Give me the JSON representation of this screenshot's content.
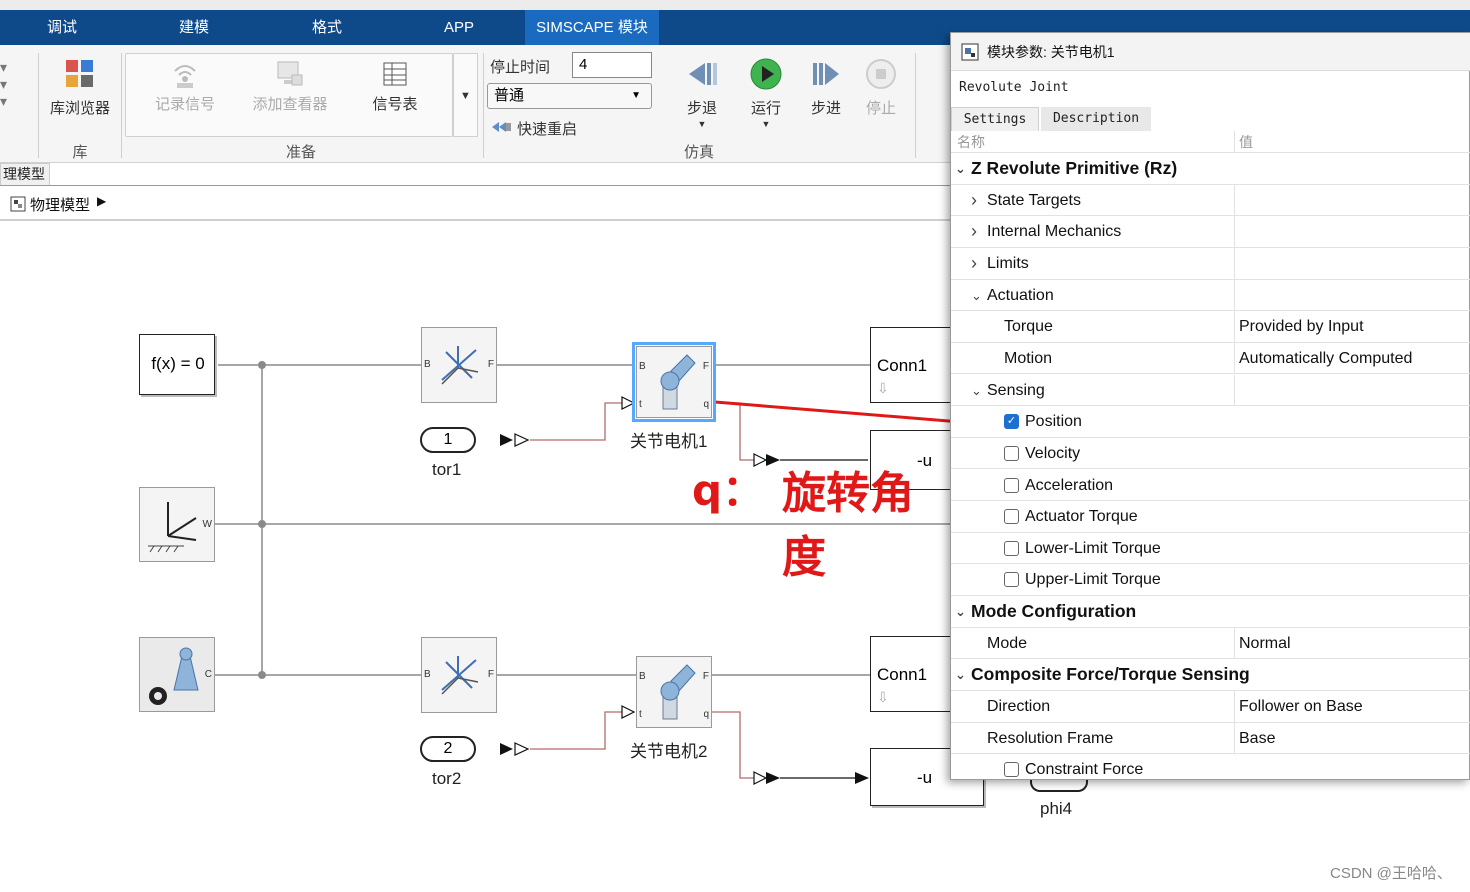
{
  "ribbon_tabs": [
    "调试",
    "建模",
    "格式",
    "APP",
    "SIMSCAPE 模块"
  ],
  "ribbon": {
    "library_browser": "库浏览器",
    "record_signal": "记录信号",
    "add_viewer": "添加查看器",
    "signal_table": "信号表",
    "stop_time_label": "停止时间",
    "stop_time_value": "4",
    "sim_mode": "普通",
    "fast_restart": "快速重启",
    "step_back": "步退",
    "run": "运行",
    "step_forward": "步进",
    "stop": "停止",
    "group_library": "库",
    "group_prepare": "准备",
    "group_simulation": "仿真"
  },
  "model_tab": "理模型",
  "breadcrumb": "物理模型",
  "diagram": {
    "fx_block": "f(x) = 0",
    "const1": "1",
    "const1_label": "tor1",
    "const2": "2",
    "const2_label": "tor2",
    "joint1_label": "关节电机1",
    "joint2_label": "关节电机2",
    "conn1_top": "Conn1",
    "conn1_bottom": "Conn1",
    "neg_u_top": "-u",
    "neg_u_bottom": "-u",
    "phi4_label": "phi4",
    "ports": {
      "b": "B",
      "f": "F",
      "t": "t",
      "q": "q",
      "w": "W",
      "c": "C"
    }
  },
  "annotation": {
    "q_label": "q：",
    "text": "旋转角度"
  },
  "dialog": {
    "title": "模块参数: 关节电机1",
    "block_type": "Revolute Joint",
    "tabs": [
      "Settings",
      "Description"
    ],
    "col_name": "名称",
    "col_value": "值",
    "rows": [
      {
        "name": "Z Revolute Primitive (Rz)",
        "type": "section"
      },
      {
        "name": "State Targets",
        "type": "collapsed"
      },
      {
        "name": "Internal Mechanics",
        "type": "collapsed"
      },
      {
        "name": "Limits",
        "type": "collapsed"
      },
      {
        "name": "Actuation",
        "type": "expanded"
      },
      {
        "name": "Torque",
        "value": "Provided by Input",
        "type": "param"
      },
      {
        "name": "Motion",
        "value": "Automatically Computed",
        "type": "param"
      },
      {
        "name": "Sensing",
        "type": "expanded"
      },
      {
        "name": "Position",
        "type": "check",
        "checked": true
      },
      {
        "name": "Velocity",
        "type": "check",
        "checked": false
      },
      {
        "name": "Acceleration",
        "type": "check",
        "checked": false
      },
      {
        "name": "Actuator Torque",
        "type": "check",
        "checked": false
      },
      {
        "name": "Lower-Limit Torque",
        "type": "check",
        "checked": false
      },
      {
        "name": "Upper-Limit Torque",
        "type": "check",
        "checked": false
      },
      {
        "name": "Mode Configuration",
        "type": "section"
      },
      {
        "name": "Mode",
        "value": "Normal",
        "type": "param1"
      },
      {
        "name": "Composite Force/Torque Sensing",
        "type": "section"
      },
      {
        "name": "Direction",
        "value": "Follower on Base",
        "type": "param1"
      },
      {
        "name": "Resolution Frame",
        "value": "Base",
        "type": "param1"
      },
      {
        "name": "Constraint Force",
        "type": "check",
        "checked": false
      }
    ]
  },
  "watermark": "CSDN @王哈哈、"
}
